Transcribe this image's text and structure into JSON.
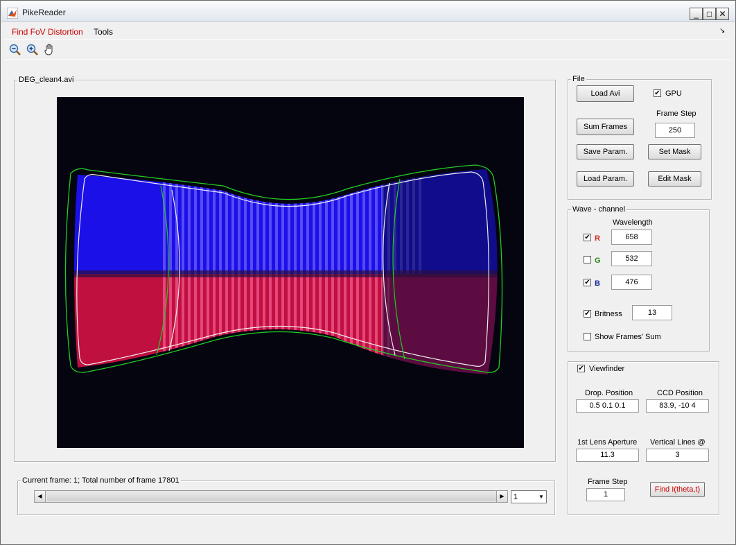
{
  "window": {
    "title": "PikeReader",
    "minimize_label": "_",
    "maximize_label": "□",
    "close_label": "✕"
  },
  "menu": {
    "items": [
      "Find FoV Distortion",
      "Tools"
    ],
    "corner_glyph": "↘"
  },
  "toolbar": {
    "icons": [
      "zoom-out-icon",
      "zoom-in-icon",
      "pan-hand-icon"
    ]
  },
  "view_panel": {
    "title": "DEG_clean4.avi"
  },
  "frame_panel": {
    "label": "Current frame: 1; Total number of frame 17801",
    "select_value": "1"
  },
  "file_panel": {
    "title": "File",
    "load_avi": "Load Avi",
    "gpu_label": "GPU",
    "gpu_checked": true,
    "frame_step_label": "Frame Step",
    "frame_step_value": "250",
    "sum_frames": "Sum Frames",
    "save_param": "Save Param.",
    "set_mask": "Set Mask",
    "load_param": "Load Param.",
    "edit_mask": "Edit Mask"
  },
  "wave_panel": {
    "title": "Wave - channel",
    "wavelength_label": "Wavelength",
    "r": {
      "label": "R",
      "checked": true,
      "value": "658"
    },
    "g": {
      "label": "G",
      "checked": false,
      "value": "532"
    },
    "b": {
      "label": "B",
      "checked": true,
      "value": "476"
    },
    "britness_label": "Britness",
    "britness_checked": true,
    "britness_value": "13",
    "show_sum_label": "Show Frames' Sum",
    "show_sum_checked": false
  },
  "viewfinder_panel": {
    "label": "Viewfinder",
    "checked": true,
    "drop_position_label": "Drop. Position",
    "drop_position_value": "0.5  0.1  0.1",
    "ccd_position_label": "CCD Position",
    "ccd_position_value": "83.9, -10 4",
    "lens_aperture_label": "1st Lens Aperture",
    "lens_aperture_value": "11.3",
    "vertical_lines_label": "Vertical Lines @",
    "vertical_lines_value": "3",
    "frame_step_label": "Frame Step",
    "frame_step_value": "1",
    "find_button": "Find I(theta,t)"
  },
  "colors": {
    "menu_accent": "#cc0000",
    "find_button_text": "#cc0000",
    "plot_background": "#050510"
  }
}
